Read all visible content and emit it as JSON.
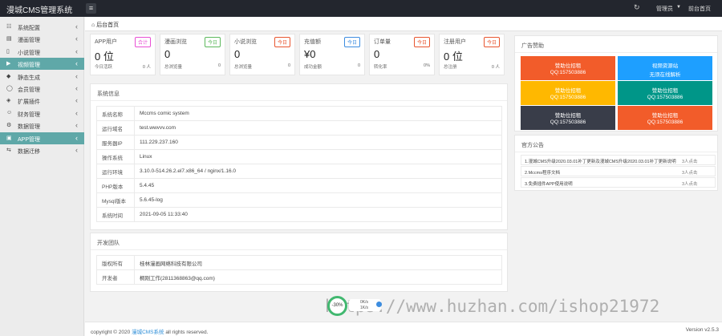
{
  "header": {
    "brand": "漫城CMS管理系统",
    "menu_toggle_icon": "hamburger-icon",
    "refresh_icon": "refresh-icon",
    "admin_label": "管理员",
    "front_label": "前台首页"
  },
  "sidebar": {
    "items": [
      {
        "icon": "settings-icon",
        "glyph": "☷",
        "label": "系统配置",
        "active": false
      },
      {
        "icon": "list-icon",
        "glyph": "▤",
        "label": "漫画管理",
        "active": false
      },
      {
        "icon": "book-icon",
        "glyph": "▯",
        "label": "小说管理",
        "active": false
      },
      {
        "icon": "video-icon",
        "glyph": "▶",
        "label": "视频管理",
        "active": true
      },
      {
        "icon": "static-icon",
        "glyph": "◆",
        "label": "静态生成",
        "active": false
      },
      {
        "icon": "chat-icon",
        "glyph": "◯",
        "label": "会员管理",
        "active": false
      },
      {
        "icon": "shield-icon",
        "glyph": "◈",
        "label": "扩展插件",
        "active": false
      },
      {
        "icon": "finance-icon",
        "glyph": "☺",
        "label": "财务管理",
        "active": false
      },
      {
        "icon": "data-icon",
        "glyph": "⚙",
        "label": "数据管理",
        "active": false
      },
      {
        "icon": "app-icon",
        "glyph": "▣",
        "label": "APP管理",
        "active": true
      },
      {
        "icon": "other-icon",
        "glyph": "⇆",
        "label": "数据迁移",
        "active": false
      }
    ]
  },
  "tabs": {
    "home_icon": "home-icon",
    "home": "后台首页"
  },
  "stats": [
    {
      "name": "APP用户",
      "badge": "合计",
      "badge_color": "#e84fd4",
      "value": "0 位",
      "foot_left": "今日活跃",
      "foot_right": "0 人"
    },
    {
      "name": "漫画浏览",
      "badge": "今日",
      "badge_color": "#5cb85c",
      "value": "0",
      "foot_left": "总浏览量",
      "foot_right": "0"
    },
    {
      "name": "小说浏览",
      "badge": "今日",
      "badge_color": "#e8552f",
      "value": "0",
      "foot_left": "总浏览量",
      "foot_right": "0"
    },
    {
      "name": "充值额",
      "badge": "今日",
      "badge_color": "#3d8de0",
      "value": "¥0",
      "foot_left": "成功金额",
      "foot_right": "0"
    },
    {
      "name": "订单量",
      "badge": "今日",
      "badge_color": "#e8552f",
      "value": "0",
      "foot_left": "转化率",
      "foot_right": "0%"
    },
    {
      "name": "注册用户",
      "badge": "今日",
      "badge_color": "#e8552f",
      "value": "0 位",
      "foot_left": "总注册",
      "foot_right": "0 人"
    }
  ],
  "system_info": {
    "title": "系统信息",
    "rows": [
      {
        "key": "系统名称",
        "value": "Mccms comic system"
      },
      {
        "key": "运行域名",
        "value": "test.wwvvv.com"
      },
      {
        "key": "服务器IP",
        "value": "111.229.237.160"
      },
      {
        "key": "操作系统",
        "value": "Linux"
      },
      {
        "key": "运行环境",
        "value": "3.10.0-514.26.2.el7.x86_64 / nginx/1.16.0"
      },
      {
        "key": "PHP版本",
        "value": "5.4.45"
      },
      {
        "key": "Mysql版本",
        "value": "5.6.45-log"
      },
      {
        "key": "系统时间",
        "value": "2021-09-05 11:33:40"
      }
    ]
  },
  "dev_team": {
    "title": "开发团队",
    "rows": [
      {
        "key": "版权所有",
        "value": "桂林漫画网络科技有限公司"
      },
      {
        "key": "开发者",
        "value": "桐刚工作(2811368863@qq.com)"
      }
    ]
  },
  "ads": {
    "title": "广告赞助",
    "items": [
      {
        "line1": "赞助位招租",
        "line2": "QQ:157503886",
        "color": "#f25c2a"
      },
      {
        "line1": "视频资源站",
        "line2": "无须在线解析",
        "color": "#1e9fff"
      },
      {
        "line1": "赞助位招租",
        "line2": "QQ:157503886",
        "color": "#ffb800"
      },
      {
        "line1": "赞助位招租",
        "line2": "QQ:157503886",
        "color": "#009688"
      },
      {
        "line1": "赞助位招租",
        "line2": "QQ:157503886",
        "color": "#393d49"
      },
      {
        "line1": "赞助位招租",
        "line2": "QQ:157503886",
        "color": "#f25c2a"
      }
    ]
  },
  "notices": {
    "title": "官方公告",
    "items": [
      {
        "text": "1.漫城CMS升级2020.03.01补丁更新及漫城CMS升级2020.03.01补丁更新说明",
        "count": "3人点击"
      },
      {
        "text": "2.Mccms程序文档",
        "count": "3人点击"
      },
      {
        "text": "3.免费插件APP使用说明",
        "count": "3人点击"
      }
    ]
  },
  "footer": {
    "copy_prefix": "copyright © 2020",
    "copy_link": "漫城CMS系统",
    "copy_suffix": "all rights reserved.",
    "version": "Version v2.5.3"
  },
  "overlay": {
    "watermark": "https://www.huzhan.com/ishop21972",
    "zoom": "-30%",
    "speed_up": "0K/s",
    "speed_down": "1K/s"
  }
}
